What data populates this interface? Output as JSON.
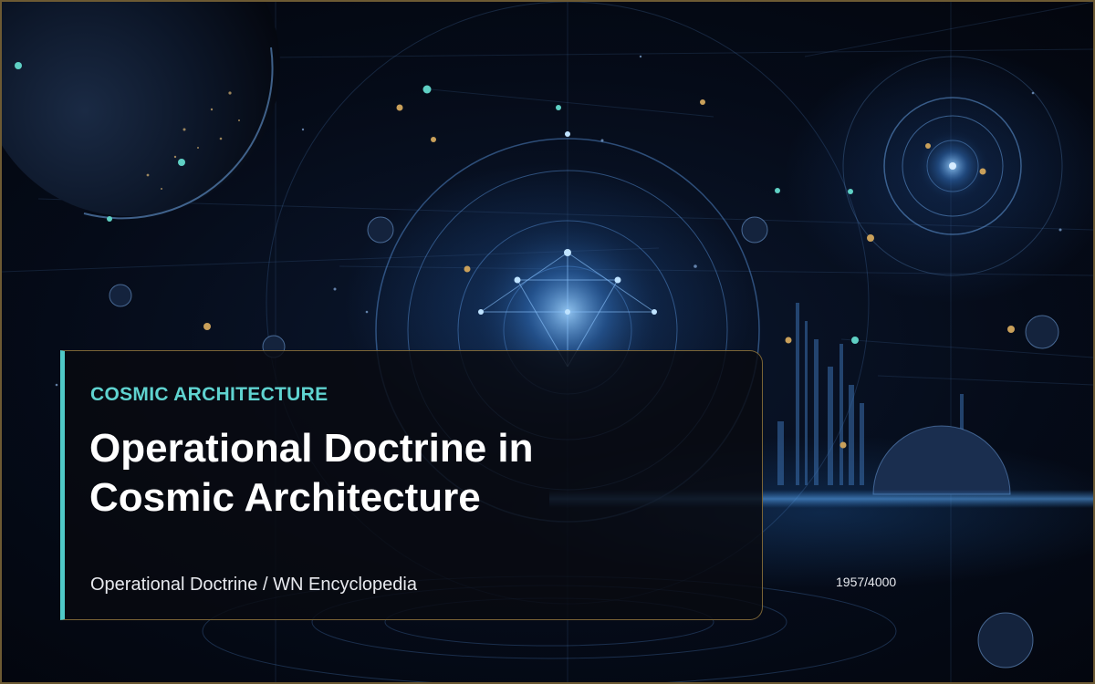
{
  "slide": {
    "category": "COSMIC ARCHITECTURE",
    "title_line1": "Operational Doctrine in",
    "title_line2": "Cosmic Architecture",
    "subtitle": "Operational Doctrine / WN Encyclopedia",
    "page_counter": "1957/4000"
  },
  "colors": {
    "accent_teal": "#4fc9c7",
    "frame_gold": "#7a6436",
    "background_navy": "#050b18"
  }
}
